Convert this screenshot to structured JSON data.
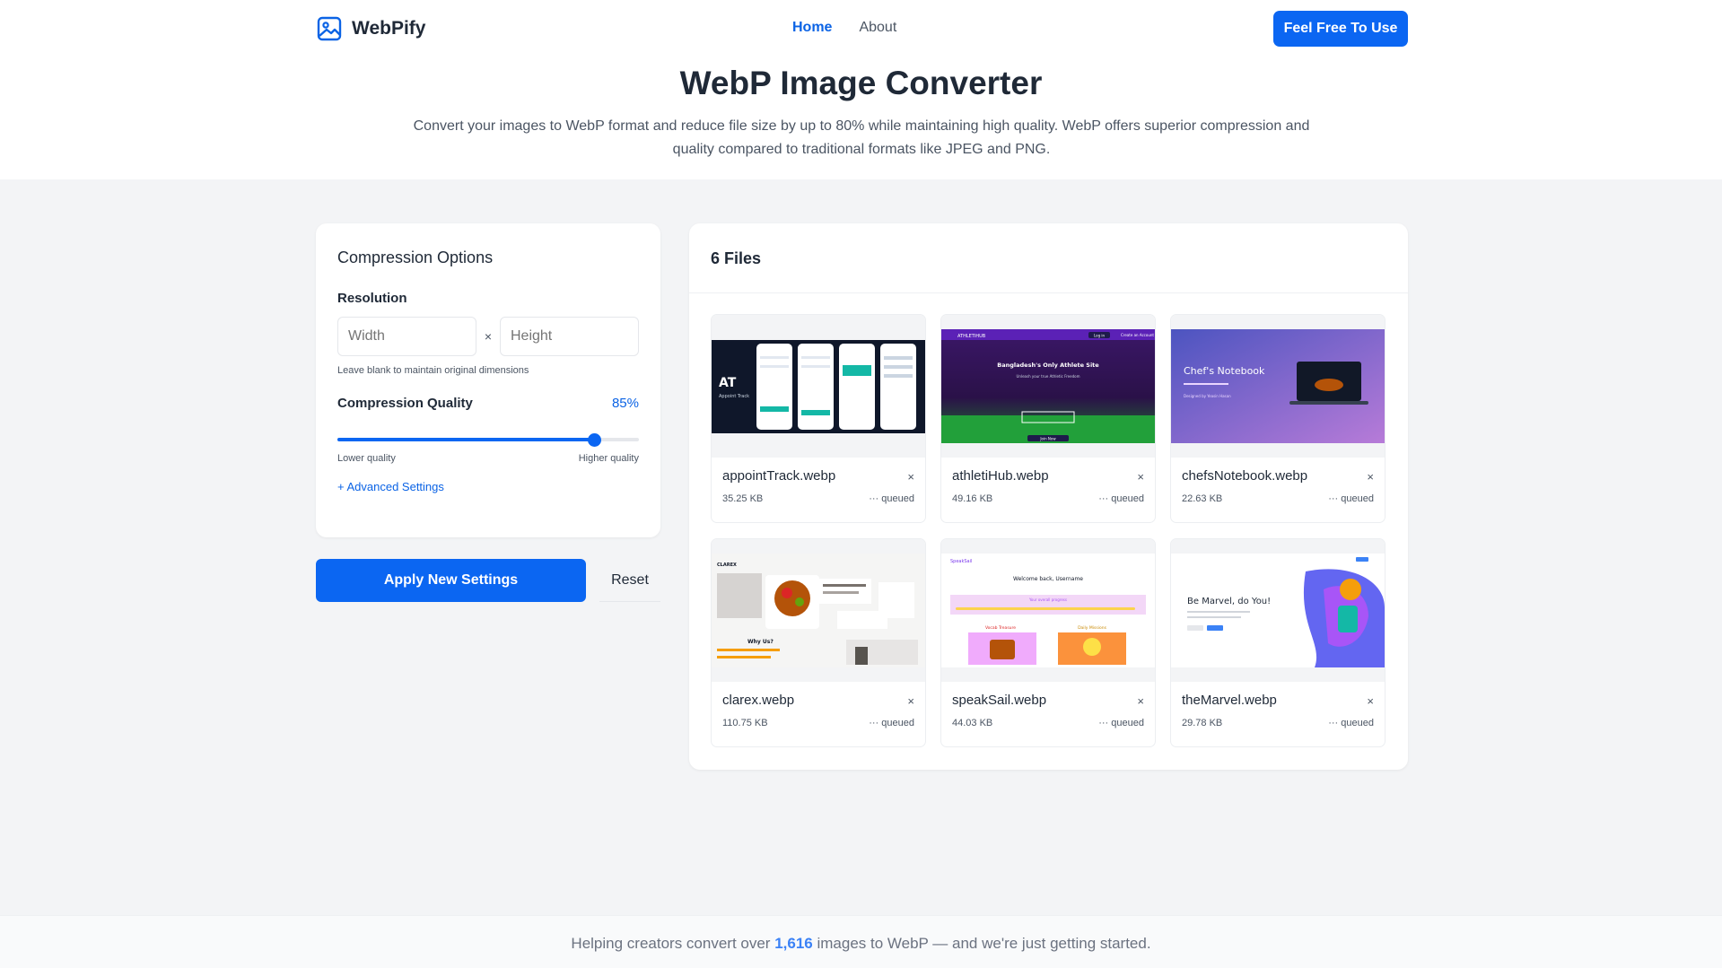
{
  "brand": {
    "name": "WebPify",
    "icon": "image-icon"
  },
  "nav": {
    "home": "Home",
    "about": "About",
    "cta": "Feel Free To Use"
  },
  "hero": {
    "title": "WebP Image Converter",
    "subtitle": "Convert your images to WebP format and reduce file size by up to 80% while maintaining high quality. WebP offers superior compression and quality compared to traditional formats like JPEG and PNG."
  },
  "options": {
    "title": "Compression Options",
    "resolution_label": "Resolution",
    "width_placeholder": "Width",
    "height_placeholder": "Height",
    "times": "×",
    "hint": "Leave blank to maintain original dimensions",
    "quality_label": "Compression Quality",
    "quality_value": "85%",
    "quality_level": 0.85,
    "lower": "Lower quality",
    "higher": "Higher quality",
    "advanced": "+ Advanced Settings"
  },
  "actions": {
    "apply": "Apply New Settings",
    "reset": "Reset"
  },
  "files": {
    "title": "6 Files",
    "items": [
      {
        "name": "appointTrack.webp",
        "size": "35.25 KB",
        "status": "··· queued",
        "close": "×"
      },
      {
        "name": "athletiHub.webp",
        "size": "49.16 KB",
        "status": "··· queued",
        "close": "×"
      },
      {
        "name": "chefsNotebook.webp",
        "size": "22.63 KB",
        "status": "··· queued",
        "close": "×"
      },
      {
        "name": "clarex.webp",
        "size": "110.75 KB",
        "status": "··· queued",
        "close": "×"
      },
      {
        "name": "speakSail.webp",
        "size": "44.03 KB",
        "status": "··· queued",
        "close": "×"
      },
      {
        "name": "theMarvel.webp",
        "size": "29.78 KB",
        "status": "··· queued",
        "close": "×"
      }
    ],
    "thumb_text": {
      "appoint": "Appoint Track",
      "athleti_brand": "ATHLETIHUB",
      "athleti_login": "Log in",
      "athleti_create": "Create an Account",
      "athleti_head": "Bangladesh's Only Athlete Site",
      "athleti_sub": "Unleash your true Athletic Freedom",
      "athleti_btn": "Join Now",
      "chef_title": "Chef's Notebook",
      "chef_sub": "Designed by Yeasin Hasan",
      "clarex_brand": "CLAREX",
      "clarex_why": "Why Us?",
      "speak_brand": "SpeakSail",
      "speak_welcome": "Welcome back, Username",
      "speak_progress": "Your overall progress",
      "speak_left": "Vocab Treasure",
      "speak_right": "Daily Missions",
      "marvel_head": "Be Marvel, do You!"
    }
  },
  "footer": {
    "prefix": "Helping creators convert over ",
    "count": "1,616",
    "suffix": " images to WebP — and we're just getting started."
  }
}
